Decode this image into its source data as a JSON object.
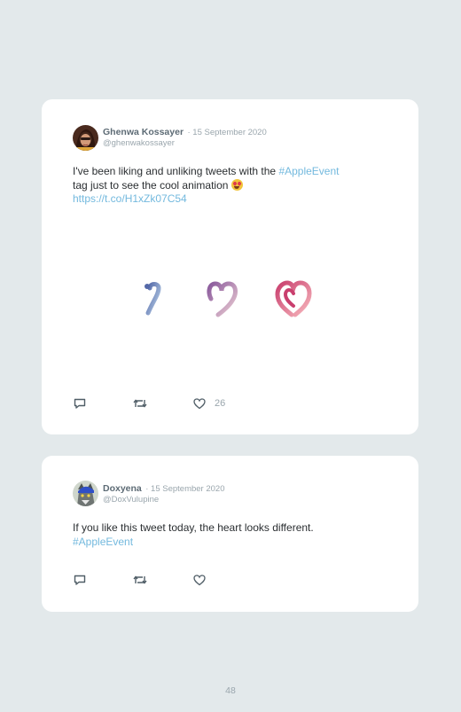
{
  "tweets": [
    {
      "author": "Ghenwa Kossayer",
      "date": "· 15 September 2020",
      "handle": "@ghenwakossayer",
      "text_before": "I've been liking and unliking tweets with the ",
      "hashtag": "#AppleEvent",
      "text_after": " tag just to see the cool animation ",
      "link": "https://t.co/H1xZk07C54",
      "like_count": "26"
    },
    {
      "author": "Doxyena",
      "date": "· 15 September 2020",
      "handle": "@DoxVulupine",
      "text": "If you like this tweet today, the heart looks different.",
      "hashtag": "#AppleEvent"
    }
  ],
  "page_number": "48",
  "icons": [
    "reply-icon",
    "retweet-icon",
    "like-icon",
    "heart-eyes-emoji",
    "animated-heart-frames"
  ],
  "colors": {
    "background": "#e3e9eb",
    "card": "#ffffff",
    "link": "#73b9de",
    "name": "#5d6b75",
    "muted": "#9aa6ad"
  }
}
